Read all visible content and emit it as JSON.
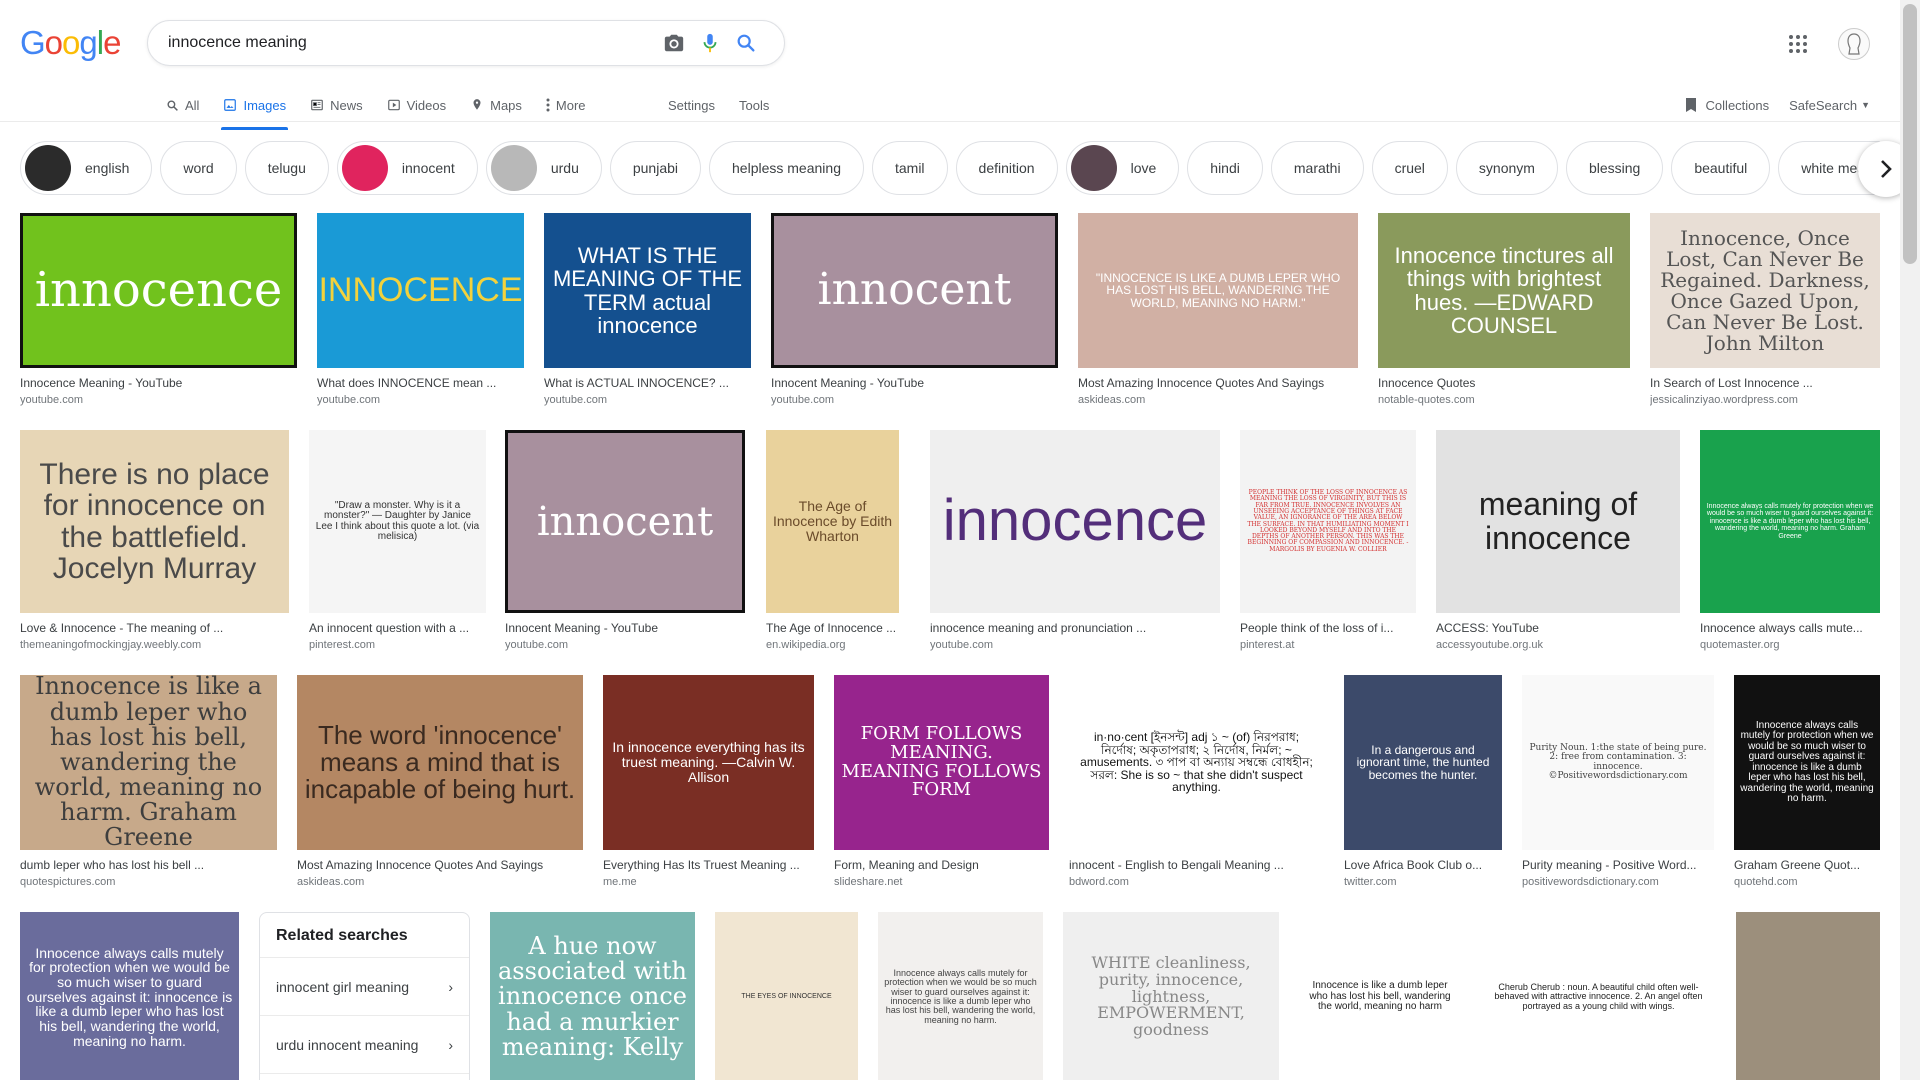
{
  "logo": {
    "letters": [
      "G",
      "o",
      "o",
      "g",
      "l",
      "e"
    ],
    "colors": [
      "#4285f4",
      "#ea4335",
      "#fbbc05",
      "#4285f4",
      "#34a853",
      "#ea4335"
    ]
  },
  "search": {
    "query": "innocence meaning"
  },
  "tabs": [
    {
      "label": "All",
      "icon": "search-icon"
    },
    {
      "label": "Images",
      "icon": "image-icon",
      "active": true
    },
    {
      "label": "News",
      "icon": "news-icon"
    },
    {
      "label": "Videos",
      "icon": "video-icon"
    },
    {
      "label": "Maps",
      "icon": "map-icon"
    },
    {
      "label": "More",
      "icon": "more-vert-icon"
    }
  ],
  "tools": {
    "settings": "Settings",
    "tools": "Tools"
  },
  "right_tools": {
    "collections": "Collections",
    "safesearch": "SafeSearch"
  },
  "chips": [
    {
      "label": "english",
      "thumb": "#2b2b2b"
    },
    {
      "label": "word"
    },
    {
      "label": "telugu"
    },
    {
      "label": "innocent",
      "thumb": "#e0245e"
    },
    {
      "label": "urdu",
      "thumb": "#b8b8b8"
    },
    {
      "label": "punjabi"
    },
    {
      "label": "helpless meaning"
    },
    {
      "label": "tamil"
    },
    {
      "label": "definition"
    },
    {
      "label": "love",
      "thumb": "#5a4650"
    },
    {
      "label": "hindi"
    },
    {
      "label": "marathi"
    },
    {
      "label": "cruel"
    },
    {
      "label": "synonym"
    },
    {
      "label": "blessing"
    },
    {
      "label": "beautiful"
    },
    {
      "label": "white means"
    }
  ],
  "results": [
    {
      "caption": "Innocence Meaning - YouTube",
      "source": "youtube.com",
      "art": "innocence",
      "bg": "#71c21d",
      "fg": "#ffffff"
    },
    {
      "caption": "What does INNOCENCE mean ...",
      "source": "youtube.com",
      "art": "INNOCENCE",
      "bg": "#1a9ad6",
      "fg": "#f3d23c"
    },
    {
      "caption": "What is ACTUAL INNOCENCE? ...",
      "source": "youtube.com",
      "art": "WHAT IS THE MEANING OF THE TERM actual innocence",
      "bg": "#14508f",
      "fg": "#ffffff"
    },
    {
      "caption": "Innocent Meaning - YouTube",
      "source": "youtube.com",
      "art": "innocent",
      "bg": "#a8909e",
      "fg": "#ffffff"
    },
    {
      "caption": "Most Amazing Innocence Quotes And Sayings",
      "source": "askideas.com",
      "art": "\"INNOCENCE IS LIKE A DUMB LEPER WHO HAS LOST HIS BELL, WANDERING THE WORLD, MEANING NO HARM.\"",
      "bg": "#d1b0a4",
      "fg": "#ffffff"
    },
    {
      "caption": "Innocence Quotes",
      "source": "notable-quotes.com",
      "art": "Innocence tinctures all things with brightest hues. —EDWARD COUNSEL",
      "bg": "#8a9a5c",
      "fg": "#ffffff"
    },
    {
      "caption": "In Search of Lost Innocence ...",
      "source": "jessicalinziyao.wordpress.com",
      "art": "Innocence, Once Lost, Can Never Be Regained. Darkness, Once Gazed Upon, Can Never Be Lost. John Milton",
      "bg": "#e8ded5",
      "fg": "#555555"
    },
    {
      "caption": "Love & Innocence - The meaning of ...",
      "source": "themeaningofmockingjay.weebly.com",
      "art": "There is no place for innocence on the battlefield. Jocelyn Murray",
      "bg": "#e7d6b6",
      "fg": "#4a4a4a"
    },
    {
      "caption": "An innocent question with a ...",
      "source": "pinterest.com",
      "art": "\"Draw a monster. Why is it a monster?\" — Daughter by Janice Lee  I think about this quote a lot. (via melisica)",
      "bg": "#f5f5f5",
      "fg": "#333333"
    },
    {
      "caption": "Innocent Meaning - YouTube",
      "source": "youtube.com",
      "art": "innocent",
      "bg": "#a8909e",
      "fg": "#ffffff"
    },
    {
      "caption": "The Age of Innocence ...",
      "source": "en.wikipedia.org",
      "art": "The Age of Innocence by Edith Wharton",
      "bg": "#e9d29c",
      "fg": "#6a4b2a"
    },
    {
      "caption": "innocence meaning and pronunciation ...",
      "source": "youtube.com",
      "art": "innocence",
      "bg": "#efefef",
      "fg": "#532e7a"
    },
    {
      "caption": "People think of the loss of i...",
      "source": "pinterest.at",
      "art": "PEOPLE THINK OF THE LOSS OF INNOCENCE AS MEANING THE LOSS OF VIRGINITY, BUT THIS IS FAR FROM TRUE. INNOCENCE INVOLVES AN UNSEEING ACCEPTANCE OF THINGS AT FACE VALUE, AN IGNORANCE OF THE AREA BELOW THE SURFACE. IN THAT HUMILIATING MOMENT I LOOKED BEYOND MYSELF AND INTO THE DEPTHS OF ANOTHER PERSON. THIS WAS THE BEGINNING OF COMPASSION AND INNOCENCE. -MARGOLIS BY EUGENIA W. COLLIER",
      "bg": "#f3f3f3",
      "fg": "#d32f2f"
    },
    {
      "caption": "ACCESS: YouTube",
      "source": "accessyoutube.org.uk",
      "art": "meaning of innocence",
      "bg": "#e2e2e2",
      "fg": "#222222"
    },
    {
      "caption": "Innocence always calls mute...",
      "source": "quotemaster.org",
      "art": "Innocence always calls mutely for protection when we would be so much wiser to guard ourselves against it: innocence is like a dumb leper who has lost his bell, wandering the world, meaning no harm. Graham Greene",
      "bg": "#19a24d",
      "fg": "#ffffff"
    },
    {
      "caption": "dumb leper who has lost his bell ...",
      "source": "quotespictures.com",
      "art": "Innocence is like a dumb leper who has lost his bell, wandering the world, meaning no harm. Graham Greene",
      "bg": "#c7a98a",
      "fg": "#3e3e3e"
    },
    {
      "caption": "Most Amazing Innocence Quotes And Sayings",
      "source": "askideas.com",
      "art": "The word 'innocence' means a mind that is incapable of being hurt.",
      "bg": "#b48763",
      "fg": "#3a2a20"
    },
    {
      "caption": "Everything Has Its Truest Meaning ...",
      "source": "me.me",
      "art": "In innocence everything has its truest meaning. —Calvin W. Allison",
      "bg": "#7a2e24",
      "fg": "#ffffff"
    },
    {
      "caption": "Form, Meaning and Design",
      "source": "slideshare.net",
      "art": "FORM FOLLOWS MEANING. MEANING FOLLOWS FORM",
      "bg": "#97248d",
      "fg": "#ffffff"
    },
    {
      "caption": "innocent - English to Bengali Meaning ...",
      "source": "bdword.com",
      "art": "in·no·cent [ইনসন্ট] adj ১ ~ (of) নিরপরাধ; নির্দোষ; অকৃতাপরাধ; ২ নির্দোষ, নির্মল; ~ amusements. ৩ পাপ বা অন্যায় সম্বন্ধে বোধহীন; সরল: She is so ~ that she didn't suspect anything.",
      "bg": "#ffffff",
      "fg": "#111111"
    },
    {
      "caption": "Love Africa Book Club o...",
      "source": "twitter.com",
      "art": "In a dangerous and ignorant time, the hunted becomes the hunter.",
      "bg": "#3c4a6a",
      "fg": "#ffffff"
    },
    {
      "caption": "Purity meaning - Positive Word...",
      "source": "positivewordsdictionary.com",
      "art": "Purity Noun. 1:the state of being pure. 2: free from contamination. 3: innocence. ©Positivewordsdictionary.com",
      "bg": "#f9f9f9",
      "fg": "#444444"
    },
    {
      "caption": "Graham Greene Quot...",
      "source": "quotehd.com",
      "art": "Innocence always calls mutely for protection when we would be so much wiser to guard ourselves against it: innocence is like a dumb leper who has lost his bell, wandering the world, meaning no harm.",
      "bg": "#111111",
      "fg": "#ffffff"
    },
    {
      "caption": "",
      "source": "",
      "art": "Innocence always calls mutely for protection when we would be so much wiser to guard ourselves against it: innocence is like a dumb leper who has lost his bell, wandering the world, meaning no harm.",
      "bg": "#6a6c9c",
      "fg": "#ffffff"
    },
    {
      "caption": "",
      "source": "",
      "art": "A hue now associated with innocence once had a murkier meaning: Kelly",
      "bg": "#79b6b0",
      "fg": "#ffffff"
    },
    {
      "caption": "",
      "source": "",
      "art": "THE EYES OF INNOCENCE",
      "bg": "#f1e6d2",
      "fg": "#333333"
    },
    {
      "caption": "",
      "source": "",
      "art": "Innocence always calls mutely for protection when we would be so much wiser to guard ourselves against it: innocence is like a dumb leper who has lost his bell, wandering the world, meaning no harm.",
      "bg": "#f2f0ee",
      "fg": "#444444"
    },
    {
      "caption": "",
      "source": "",
      "art": "WHITE cleanliness, purity, innocence, lightness, EMPOWERMENT, goodness",
      "bg": "#efefef",
      "fg": "#888888"
    },
    {
      "caption": "",
      "source": "",
      "art": "Innocence is like a dumb leper who has lost his bell, wandering the world, meaning no harm",
      "bg": "#ffffff",
      "fg": "#222222"
    },
    {
      "caption": "",
      "source": "",
      "art": "Cherub Cherub : noun. A beautiful child often well-behaved with attractive innocence. 2. An angel often portrayed as a young child with wings.",
      "bg": "#ffffff",
      "fg": "#222222"
    },
    {
      "caption": "",
      "source": "",
      "art": "",
      "bg": "#9c8f7c",
      "fg": "#ffffff"
    }
  ],
  "related": {
    "title": "Related searches",
    "items": [
      "innocent girl meaning",
      "urdu innocent meaning"
    ]
  }
}
